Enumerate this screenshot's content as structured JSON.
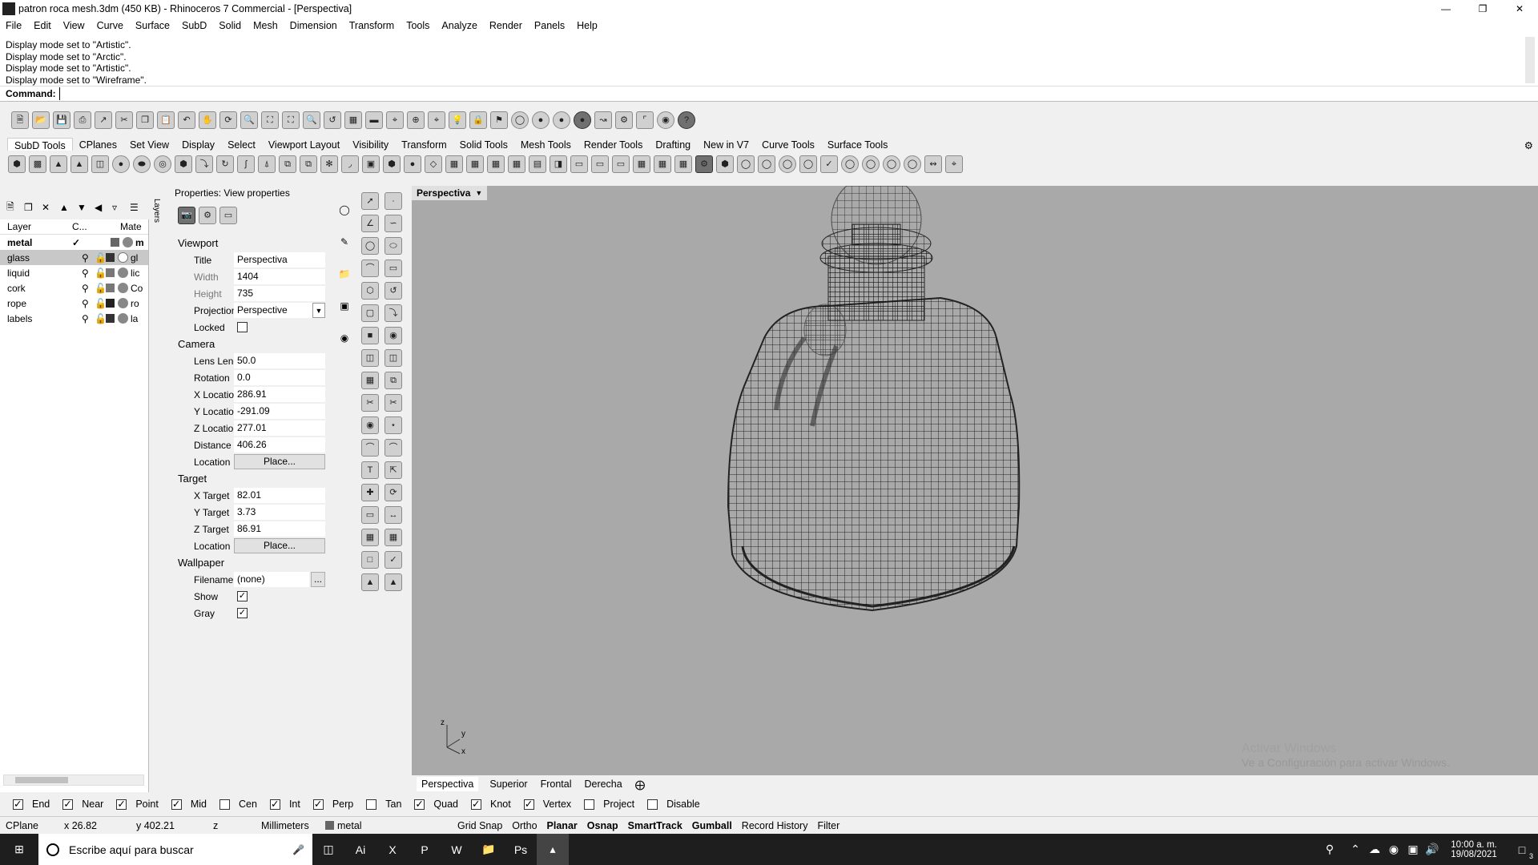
{
  "window": {
    "title": "patron roca mesh.3dm (450 KB) - Rhinoceros 7 Commercial - [Perspectiva]"
  },
  "menu": [
    "File",
    "Edit",
    "View",
    "Curve",
    "Surface",
    "SubD",
    "Solid",
    "Mesh",
    "Dimension",
    "Transform",
    "Tools",
    "Analyze",
    "Render",
    "Panels",
    "Help"
  ],
  "command_history": [
    "Display mode set to \"Artistic\".",
    "Display mode set to \"Arctic\".",
    "Display mode set to \"Artistic\".",
    "Display mode set to \"Wireframe\"."
  ],
  "command_prompt": "Command:",
  "toolbar_tabs": [
    "SubD Tools",
    "CPlanes",
    "Set View",
    "Display",
    "Select",
    "Viewport Layout",
    "Visibility",
    "Transform",
    "Solid Tools",
    "Mesh Tools",
    "Render Tools",
    "Drafting",
    "New in V7",
    "Curve Tools",
    "Surface Tools"
  ],
  "layers": {
    "headers": [
      "Layer",
      "C...",
      "Mate"
    ],
    "tab_label": "Layers",
    "rows": [
      {
        "name": "metal",
        "mat": "m"
      },
      {
        "name": "glass",
        "mat": "gl"
      },
      {
        "name": "liquid",
        "mat": "lic"
      },
      {
        "name": "cork",
        "mat": "Co"
      },
      {
        "name": "rope",
        "mat": "ro"
      },
      {
        "name": "labels",
        "mat": "la"
      }
    ]
  },
  "properties": {
    "title": "Properties: View properties",
    "viewport_section": "Viewport",
    "title_label": "Title",
    "title_value": "Perspectiva",
    "width_label": "Width",
    "width_value": "1404",
    "height_label": "Height",
    "height_value": "735",
    "projection_label": "Projection",
    "projection_value": "Perspective",
    "locked_label": "Locked",
    "camera_section": "Camera",
    "lens_label": "Lens Length",
    "lens_value": "50.0",
    "rotation_label": "Rotation",
    "rotation_value": "0.0",
    "xloc_label": "X Location",
    "xloc_value": "286.91",
    "yloc_label": "Y Location",
    "yloc_value": "-291.09",
    "zloc_label": "Z Location",
    "zloc_value": "277.01",
    "dist_label": "Distance to ...",
    "dist_value": "406.26",
    "location_label": "Location",
    "place_label": "Place...",
    "target_section": "Target",
    "xt_label": "X Target",
    "xt_value": "82.01",
    "yt_label": "Y Target",
    "yt_value": "3.73",
    "zt_label": "Z Target",
    "zt_value": "86.91",
    "wallpaper_section": "Wallpaper",
    "filename_label": "Filename",
    "filename_value": "(none)",
    "browse_label": "...",
    "show_label": "Show",
    "gray_label": "Gray"
  },
  "viewport": {
    "name": "Perspectiva",
    "axis_z": "z",
    "axis_y": "y",
    "axis_x": "x",
    "watermark_1": "Activar Windows",
    "watermark_2": "Ve a Configuración para activar Windows."
  },
  "viewport_tabs": [
    "Perspectiva",
    "Superior",
    "Frontal",
    "Derecha"
  ],
  "osnap": [
    {
      "label": "End",
      "checked": true
    },
    {
      "label": "Near",
      "checked": true
    },
    {
      "label": "Point",
      "checked": true
    },
    {
      "label": "Mid",
      "checked": true
    },
    {
      "label": "Cen",
      "checked": false
    },
    {
      "label": "Int",
      "checked": true
    },
    {
      "label": "Perp",
      "checked": true
    },
    {
      "label": "Tan",
      "checked": false
    },
    {
      "label": "Quad",
      "checked": true
    },
    {
      "label": "Knot",
      "checked": true
    },
    {
      "label": "Vertex",
      "checked": true
    },
    {
      "label": "Project",
      "checked": false
    },
    {
      "label": "Disable",
      "checked": false
    }
  ],
  "status": {
    "cplane": "CPlane",
    "x": "x 26.82",
    "y": "y 402.21",
    "z": "z",
    "units": "Millimeters",
    "layer": "metal",
    "toggles": [
      "Grid Snap",
      "Ortho",
      "Planar",
      "Osnap",
      "SmartTrack",
      "Gumball",
      "Record History",
      "Filter"
    ]
  },
  "taskbar": {
    "search_placeholder": "Escribe aquí para buscar",
    "time": "10:00 a. m.",
    "date": "19/08/2021",
    "notif_count": "3"
  }
}
